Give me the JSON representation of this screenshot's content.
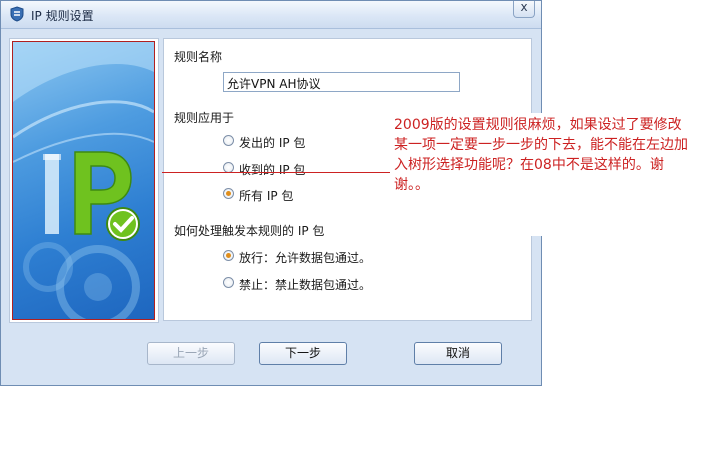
{
  "window": {
    "title": "IP 规则设置",
    "close_label": "x"
  },
  "rule_name": {
    "label": "规则名称",
    "value": "允许VPN AH协议"
  },
  "apply_to": {
    "label": "规则应用于",
    "options": [
      "发出的 IP 包",
      "收到的 IP 包",
      "所有 IP 包"
    ],
    "selected": 2
  },
  "action": {
    "label": "如何处理触发本规则的 IP 包",
    "options": [
      "放行：允许数据包通过。",
      "禁止：禁止数据包通过。"
    ],
    "selected": 0
  },
  "buttons": {
    "back": "上一步",
    "next": "下一步",
    "cancel": "取消"
  },
  "annotation": "2009版的设置规则很麻烦，如果设过了要修改某一项一定要一步一步的下去，能不能在左边加入树形选择功能呢？在08中不是这样的。谢谢。。",
  "colors": {
    "annotation_red": "#cc2222",
    "radio_selected": "#e08e1b",
    "logo_green": "#6fc21f",
    "panel_blue": "#2e7fd2"
  }
}
